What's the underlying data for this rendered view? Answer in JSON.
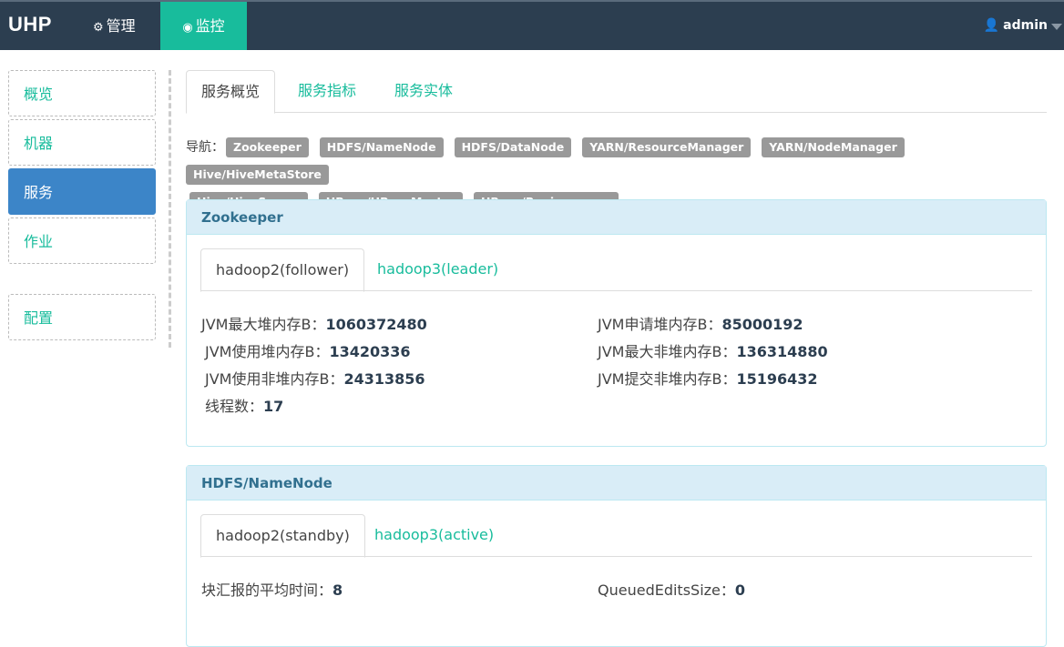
{
  "topbar": {
    "brand": "UHP",
    "nav": [
      {
        "label": "管理",
        "icon": "gears-icon"
      },
      {
        "label": "监控",
        "icon": "eye-icon"
      }
    ],
    "user": "admin"
  },
  "sidebar": {
    "items": [
      {
        "label": "概览"
      },
      {
        "label": "机器"
      },
      {
        "label": "服务",
        "active": true
      },
      {
        "label": "作业"
      },
      {
        "label": "配置"
      }
    ]
  },
  "main": {
    "tabs": [
      "服务概览",
      "服务指标",
      "服务实体"
    ],
    "nav_label": "导航：",
    "nav_badges": [
      "Zookeeper",
      "HDFS/NameNode",
      "HDFS/DataNode",
      "YARN/ResourceManager",
      "YARN/NodeManager",
      "Hive/HiveMetaStore",
      "Hive/HiveServer",
      "HBase/HBaseMaster",
      "HBase/Regionserver"
    ]
  },
  "panels": [
    {
      "title": "Zookeeper",
      "tabs": [
        "hadoop2(follower)",
        "hadoop3(leader)"
      ],
      "metrics": [
        {
          "left": {
            "label": "JVM最大堆内存B：",
            "value": "1060372480"
          },
          "right": {
            "label": "JVM申请堆内存B：",
            "value": "85000192"
          }
        },
        {
          "left": {
            "label": " JVM使用堆内存B：",
            "value": "13420336"
          },
          "right": {
            "label": "JVM最大非堆内存B：",
            "value": "136314880"
          }
        },
        {
          "left": {
            "label": " JVM使用非堆内存B：",
            "value": "24313856"
          },
          "right": {
            "label": "JVM提交非堆内存B：",
            "value": "15196432"
          }
        },
        {
          "left": {
            "label": " 线程数：",
            "value": "17"
          },
          "right": null
        }
      ]
    },
    {
      "title": "HDFS/NameNode",
      "tabs": [
        "hadoop2(standby)",
        "hadoop3(active)"
      ],
      "metrics": [
        {
          "left": {
            "label": "块汇报的平均时间：",
            "value": "8"
          },
          "right": {
            "label": "QueuedEditsSize：",
            "value": "0"
          }
        }
      ]
    }
  ]
}
